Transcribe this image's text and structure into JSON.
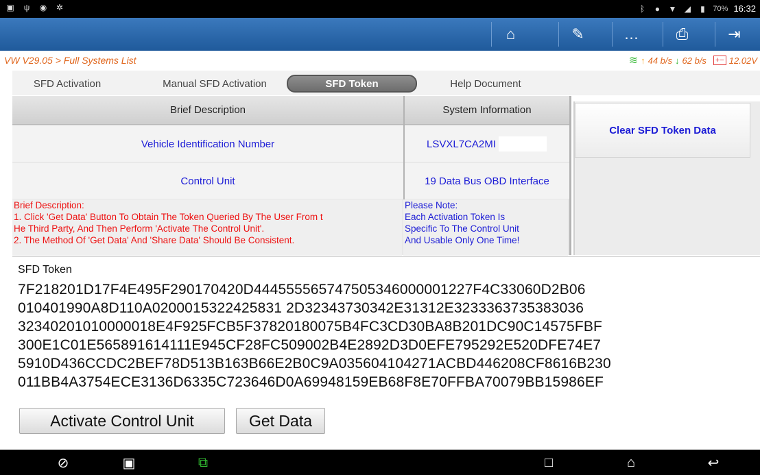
{
  "statusbar": {
    "left_icons": [
      "image-icon",
      "usb-icon",
      "shield-icon",
      "debug-icon"
    ],
    "right_icons": [
      "bluetooth-icon",
      "sync-icon",
      "wifi-icon",
      "signal-icon",
      "battery-icon"
    ],
    "battery_percent": "70%",
    "time": "16:32"
  },
  "header": {
    "buttons": [
      {
        "name": "home",
        "glyph": "⌂"
      },
      {
        "name": "edit",
        "glyph": "✎"
      },
      {
        "name": "chat",
        "glyph": "…"
      },
      {
        "name": "print",
        "glyph": "⎙"
      },
      {
        "name": "exit",
        "glyph": "⇥"
      }
    ]
  },
  "breadcrumb": "VW V29.05 > Full Systems List",
  "network": {
    "upload": "44 b/s",
    "download": "62 b/s",
    "voltage": "12.02V"
  },
  "tabs": [
    {
      "label": "SFD Activation",
      "active": false
    },
    {
      "label": "Manual SFD Activation",
      "active": false
    },
    {
      "label": "SFD Token",
      "active": true
    },
    {
      "label": "Help Document",
      "active": false
    }
  ],
  "table": {
    "col1_header": "Brief Description",
    "col2_header": "System Information",
    "rows": [
      {
        "label": "Vehicle Identification Number",
        "value": "LSVXL7CA2MI"
      },
      {
        "label": "Control Unit",
        "value": "19 Data Bus OBD Interface"
      }
    ]
  },
  "brief": {
    "title": "Brief Description:",
    "line1": "1. Click 'Get Data' Button To Obtain The Token Queried By The User From t",
    "line2": "He Third Party, And Then Perform 'Activate The Control Unit'.",
    "line3": "2. The Method Of 'Get Data' And 'Share Data' Should Be Consistent."
  },
  "note": {
    "title": "Please Note:",
    "line1": "Each Activation Token Is",
    "line2": "Specific To The Control Unit",
    "line3": "And Usable Only One Time!"
  },
  "side": {
    "clear_label": "Clear SFD Token Data"
  },
  "token": {
    "label": "SFD Token",
    "lines": [
      "7F218201D17F4E495F290170420D444555565747505346000001227F4C33060D2B06",
      "010401990A8D110A0200015322425831 2D32343730342E31312E3233363735383036",
      "32340201010000018E4F925FCB5F37820180075B4FC3CD30BA8B201DC90C14575FBF",
      "300E1C01E565891614111E945CF28FC509002B4E2892D3D0EFE795292E520DFE74E7",
      "5910D436CCDC2BEF78D513B163B66E2B0C9A035604104271ACBD446208CF8616B230",
      "011BB4A3754ECE3136D6335C723646D0A69948159EB68F8E70FFBA70079BB15986EF"
    ],
    "activate_label": "Activate Control Unit",
    "getdata_label": "Get Data"
  },
  "navbar": {
    "icons": [
      "vpn-icon",
      "gallery-icon",
      "vci-icon",
      "recents-icon",
      "home-icon",
      "back-icon"
    ]
  },
  "colors": {
    "header": "#2d6aae",
    "accent_text": "#1c1cd6",
    "warning_text": "#ee1111",
    "breadcrumb": "#e0651b"
  }
}
